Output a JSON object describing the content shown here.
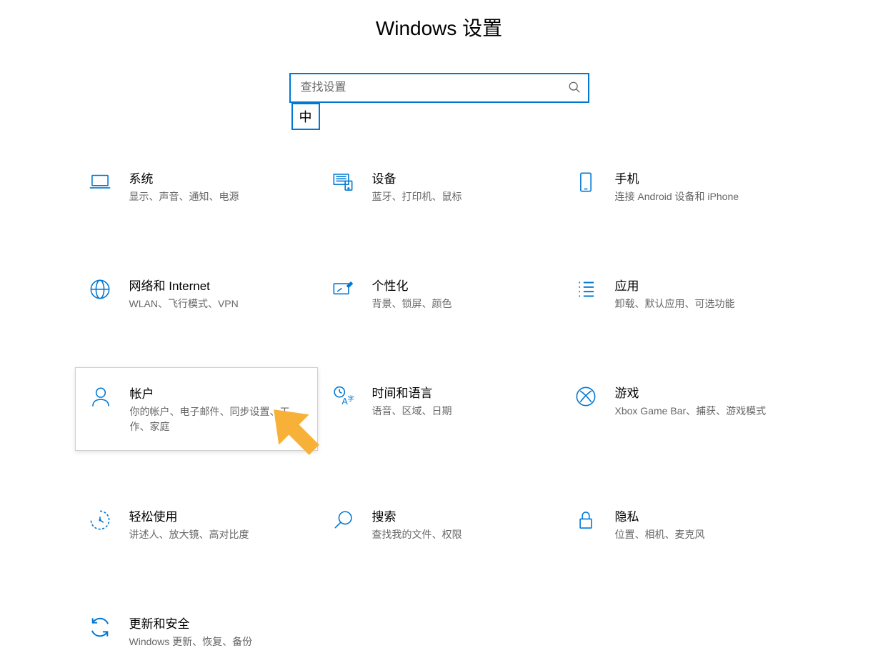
{
  "page_title": "Windows 设置",
  "search": {
    "placeholder": "查找设置"
  },
  "ime_badge": "中",
  "tiles": [
    {
      "id": "system",
      "title": "系统",
      "desc": "显示、声音、通知、电源"
    },
    {
      "id": "devices",
      "title": "设备",
      "desc": "蓝牙、打印机、鼠标"
    },
    {
      "id": "phone",
      "title": "手机",
      "desc": "连接 Android 设备和 iPhone"
    },
    {
      "id": "network",
      "title": "网络和 Internet",
      "desc": "WLAN、飞行模式、VPN"
    },
    {
      "id": "personalization",
      "title": "个性化",
      "desc": "背景、锁屏、颜色"
    },
    {
      "id": "apps",
      "title": "应用",
      "desc": "卸载、默认应用、可选功能"
    },
    {
      "id": "accounts",
      "title": "帐户",
      "desc": "你的帐户、电子邮件、同步设置、工作、家庭"
    },
    {
      "id": "time-language",
      "title": "时间和语言",
      "desc": "语音、区域、日期"
    },
    {
      "id": "gaming",
      "title": "游戏",
      "desc": "Xbox Game Bar、捕获、游戏模式"
    },
    {
      "id": "ease-of-access",
      "title": "轻松使用",
      "desc": "讲述人、放大镜、高对比度"
    },
    {
      "id": "search",
      "title": "搜索",
      "desc": "查找我的文件、权限"
    },
    {
      "id": "privacy",
      "title": "隐私",
      "desc": "位置、相机、麦克风"
    },
    {
      "id": "update",
      "title": "更新和安全",
      "desc": "Windows 更新、恢复、备份"
    }
  ],
  "highlighted_tile": "accounts",
  "colors": {
    "accent": "#0078d4",
    "text_secondary": "#666666",
    "arrow": "#f7b138"
  }
}
